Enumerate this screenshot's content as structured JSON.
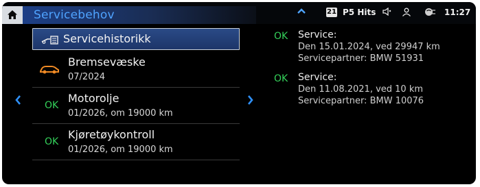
{
  "header": {
    "title": "Servicebehov",
    "status": {
      "channel_badge": "21",
      "station": "P5 Hits",
      "time": "11:27"
    }
  },
  "service_list": {
    "header_label": "Servicehistorikk",
    "items": [
      {
        "status": "",
        "icon": "car-warning-icon",
        "title": "Bremsevæske",
        "detail": "07/2024"
      },
      {
        "status": "OK",
        "title": "Motorolje",
        "detail": "01/2026, om 19000 km"
      },
      {
        "status": "OK",
        "title": "Kjøretøykontroll",
        "detail": "01/2026, om 19000 km"
      }
    ]
  },
  "history": [
    {
      "status": "OK",
      "title": "Service:",
      "line1": "Den 15.01.2024, ved 29947 km",
      "line2": "Servicepartner: BMW 51931"
    },
    {
      "status": "OK",
      "title": "Service:",
      "line1": "Den 11.08.2021, ved 10 km",
      "line2": "Servicepartner: BMW 10076"
    }
  ],
  "colors": {
    "accent_blue": "#4fa3ff",
    "ok_green": "#34d15a",
    "warning_orange": "#f08a24"
  }
}
